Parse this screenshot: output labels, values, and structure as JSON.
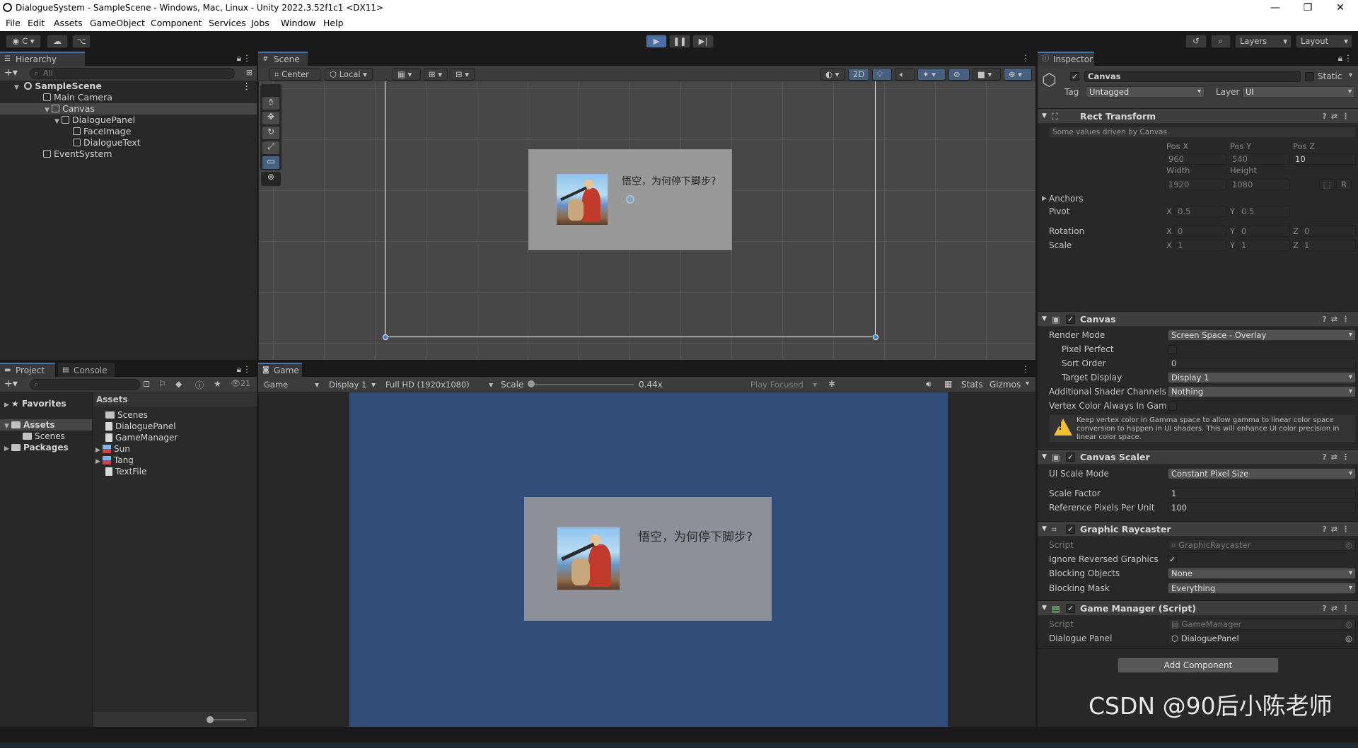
{
  "window": {
    "title": "DialogueSystem - SampleScene - Windows, Mac, Linux - Unity 2022.3.52f1c1 <DX11>",
    "minimize": "—",
    "restore": "❐",
    "close": "✕"
  },
  "menu": [
    "File",
    "Edit",
    "Assets",
    "GameObject",
    "Component",
    "Services",
    "Jobs",
    "Window",
    "Help"
  ],
  "toolbar": {
    "account_label": "C",
    "layers_label": "Layers",
    "layout_label": "Layout"
  },
  "hierarchy": {
    "tab": "Hierarchy",
    "search_placeholder": "All",
    "items": [
      {
        "label": "SampleScene",
        "depth": 0
      },
      {
        "label": "Main Camera",
        "depth": 1
      },
      {
        "label": "Canvas",
        "depth": 1
      },
      {
        "label": "DialoguePanel",
        "depth": 2
      },
      {
        "label": "FaceImage",
        "depth": 3
      },
      {
        "label": "DialogueText",
        "depth": 3
      },
      {
        "label": "EventSystem",
        "depth": 1
      }
    ]
  },
  "scene": {
    "tab": "Scene",
    "pivot_label": "Center",
    "space_label": "Local",
    "mode_2d": "2D",
    "dialogue_text": "悟空，为何停下脚步?"
  },
  "project": {
    "tabs": [
      "Project",
      "Console"
    ],
    "hidden_count": "21",
    "left_tree": [
      {
        "label": "Favorites",
        "bold": true
      },
      {
        "label": "Assets",
        "bold": true
      },
      {
        "label": "Scenes",
        "bold": false
      },
      {
        "label": "Packages",
        "bold": true
      }
    ],
    "assets_header": "Assets",
    "assets": [
      "Scenes",
      "DialoguePanel",
      "GameManager",
      "Sun",
      "Tang",
      "TextFile"
    ]
  },
  "game": {
    "tab": "Game",
    "mode": "Game",
    "display": "Display 1",
    "resolution": "Full HD (1920x1080)",
    "scale_label": "Scale",
    "scale_value": "0.44x",
    "play_focused": "Play Focused",
    "stats": "Stats",
    "gizmos": "Gizmos",
    "dialogue_text": "悟空，为何停下脚步?"
  },
  "inspector": {
    "tab": "Inspector",
    "object_name": "Canvas",
    "static_label": "Static",
    "tag_label": "Tag",
    "tag_value": "Untagged",
    "layer_label": "Layer",
    "layer_value": "UI",
    "rect_transform": {
      "title": "Rect Transform",
      "note": "Some values driven by Canvas.",
      "posx_label": "Pos X",
      "posy_label": "Pos Y",
      "posz_label": "Pos Z",
      "posx": "960",
      "posy": "540",
      "posz": "10",
      "width_label": "Width",
      "height_label": "Height",
      "width": "1920",
      "height": "1080",
      "anchors_label": "Anchors",
      "pivot_label": "Pivot",
      "pivot_x": "0.5",
      "pivot_y": "0.5",
      "rotation_label": "Rotation",
      "rot_x": "0",
      "rot_y": "0",
      "rot_z": "0",
      "scale_label": "Scale",
      "scale_x": "1",
      "scale_y": "1",
      "scale_z": "1",
      "r_button": "R"
    },
    "canvas": {
      "title": "Canvas",
      "render_mode_label": "Render Mode",
      "render_mode": "Screen Space - Overlay",
      "pixel_perfect_label": "Pixel Perfect",
      "sort_order_label": "Sort Order",
      "sort_order": "0",
      "target_display_label": "Target Display",
      "target_display": "Display 1",
      "shader_channels_label": "Additional Shader Channels",
      "shader_channels": "Nothing",
      "vertex_color_label": "Vertex Color Always In Gamm",
      "warning": "Keep vertex color in Gamma space to allow gamma to linear color space conversion to happen in UI shaders. This will enhance UI color precision in linear color space."
    },
    "canvas_scaler": {
      "title": "Canvas Scaler",
      "ui_scale_mode_label": "UI Scale Mode",
      "ui_scale_mode": "Constant Pixel Size",
      "scale_factor_label": "Scale Factor",
      "scale_factor": "1",
      "ref_ppu_label": "Reference Pixels Per Unit",
      "ref_ppu": "100"
    },
    "graphic_raycaster": {
      "title": "Graphic Raycaster",
      "script_label": "Script",
      "script": "GraphicRaycaster",
      "ignore_reversed_label": "Ignore Reversed Graphics",
      "blocking_objects_label": "Blocking Objects",
      "blocking_objects": "None",
      "blocking_mask_label": "Blocking Mask",
      "blocking_mask": "Everything"
    },
    "game_manager": {
      "title": "Game Manager (Script)",
      "script_label": "Script",
      "script": "GameManager",
      "dialogue_panel_label": "Dialogue Panel",
      "dialogue_panel": "DialoguePanel"
    },
    "add_component": "Add Component"
  },
  "watermark": "CSDN @90后小陈老师",
  "colors": {
    "game_bg": "#314d79",
    "panel_bg": "#8d8f99",
    "accent": "#3a79bb"
  }
}
